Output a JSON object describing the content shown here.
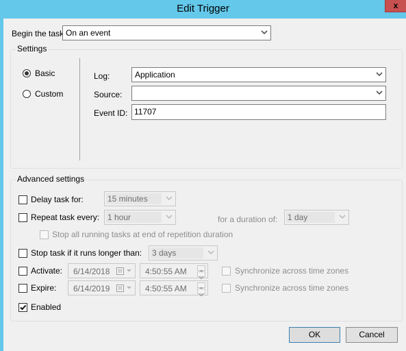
{
  "window": {
    "title": "Edit Trigger",
    "close_glyph": "x"
  },
  "begin_task": {
    "label": "Begin the task:",
    "value": "On an event"
  },
  "settings": {
    "group_title": "Settings",
    "radios": [
      {
        "label": "Basic",
        "selected": true
      },
      {
        "label": "Custom",
        "selected": false
      }
    ],
    "log": {
      "label": "Log:",
      "value": "Application"
    },
    "source": {
      "label": "Source:",
      "value": ""
    },
    "event_id": {
      "label": "Event ID:",
      "value": "11707"
    }
  },
  "advanced": {
    "group_title": "Advanced settings",
    "delay": {
      "label": "Delay task for:",
      "checked": false,
      "value": "15 minutes"
    },
    "repeat": {
      "label": "Repeat task every:",
      "checked": false,
      "value": "1 hour",
      "duration_label": "for a duration of:",
      "duration_value": "1 day"
    },
    "stop_all": {
      "label": "Stop all running tasks at end of repetition duration",
      "checked": false
    },
    "stop_longer": {
      "label": "Stop task if it runs longer than:",
      "checked": false,
      "value": "3 days"
    },
    "activate": {
      "label": "Activate:",
      "checked": false,
      "date": "6/14/2018",
      "time": "4:50:55 AM",
      "sync_label": "Synchronize across time zones",
      "sync_checked": false
    },
    "expire": {
      "label": "Expire:",
      "checked": false,
      "date": "6/14/2019",
      "time": "4:50:55 AM",
      "sync_label": "Synchronize across time zones",
      "sync_checked": false
    },
    "enabled": {
      "label": "Enabled",
      "checked": true
    }
  },
  "buttons": {
    "ok": "OK",
    "cancel": "Cancel"
  }
}
